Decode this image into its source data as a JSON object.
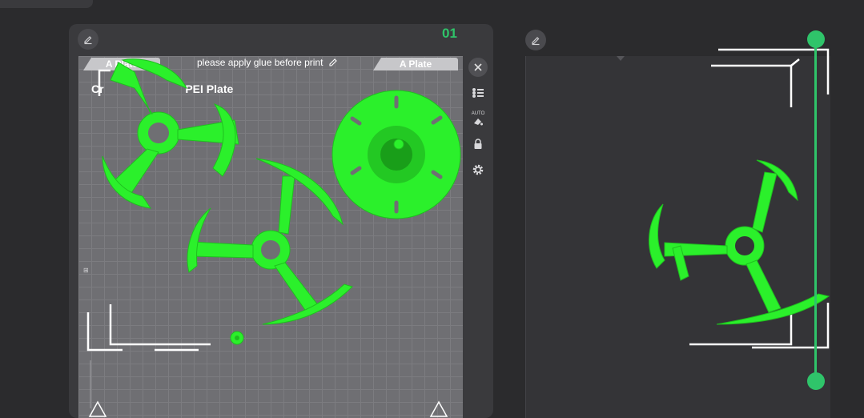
{
  "left_plate": {
    "number": "01",
    "tab_left": "A Plate",
    "tab_right": "A Plate",
    "glue_note": "please apply glue before print",
    "plate_name": "PEI Plate",
    "plate_name_prefix": "Cr",
    "auto_label": "AUTO"
  },
  "colors": {
    "accent": "#2fc46a",
    "model": "#2bf02b",
    "bed": "#6f6f73"
  },
  "icons": [
    "edit-icon",
    "close-icon",
    "list-icon",
    "auto-arrange-icon",
    "lock-icon",
    "settings-icon"
  ]
}
